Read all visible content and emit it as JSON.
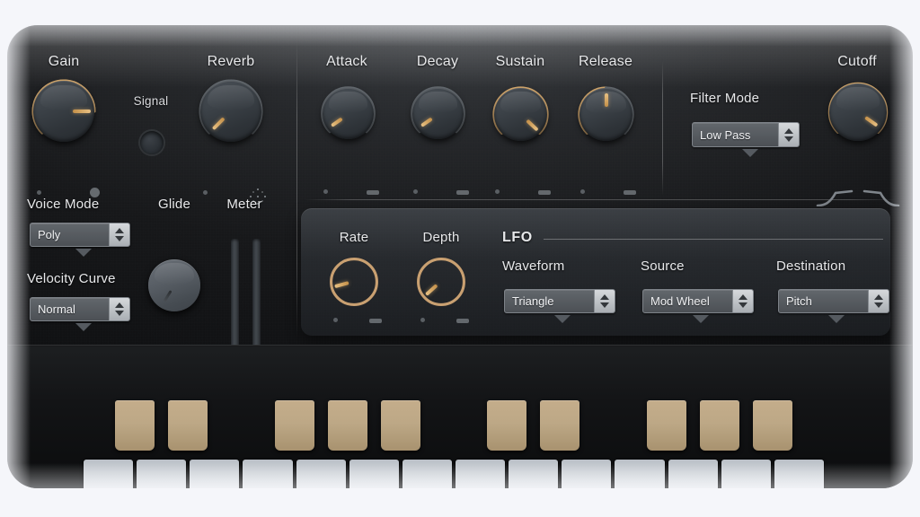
{
  "device": {
    "background_color": "#1a1c1e",
    "accent_color": "#e0b274",
    "page_background": "#f5f6fa"
  },
  "output_section": {
    "gain": {
      "label": "Gain",
      "arc": "active",
      "value_angle": 90
    },
    "signal": {
      "label": "Signal",
      "led_state": "off"
    },
    "reverb": {
      "label": "Reverb",
      "arc": "inactive",
      "value_angle": 225
    }
  },
  "voice_section": {
    "voice_mode": {
      "label": "Voice Mode",
      "value": "Poly"
    },
    "velocity_curve": {
      "label": "Velocity Curve",
      "value": "Normal"
    },
    "glide": {
      "label": "Glide",
      "value_angle": 212
    },
    "meter": {
      "label": "Meter",
      "bars": 2,
      "level": 0
    }
  },
  "envelope_section": {
    "knobs": [
      {
        "label": "Attack",
        "arc": "inactive",
        "value_angle": 215
      },
      {
        "label": "Decay",
        "arc": "inactive",
        "value_angle": 215
      },
      {
        "label": "Sustain",
        "arc": "active",
        "value_angle": 135
      },
      {
        "label": "Release",
        "arc": "active",
        "value_angle": 0
      }
    ]
  },
  "filter_section": {
    "filter_mode": {
      "label": "Filter Mode",
      "value": "Low Pass"
    },
    "cutoff": {
      "label": "Cutoff",
      "arc": "active",
      "value_angle": 125
    }
  },
  "lfo_section": {
    "title": "LFO",
    "rate": {
      "label": "Rate",
      "value_angle": 255
    },
    "depth": {
      "label": "Depth",
      "value_angle": 215
    },
    "waveform": {
      "label": "Waveform",
      "value": "Triangle"
    },
    "source": {
      "label": "Source",
      "value": "Mod Wheel"
    },
    "destination": {
      "label": "Destination",
      "value": "Pitch"
    }
  },
  "keyboard": {
    "white_key_count": 14,
    "black_key_pattern": [
      1,
      1,
      0,
      1,
      1,
      1,
      0,
      1,
      1,
      0,
      1,
      1,
      1,
      0
    ],
    "white_key_color": "#eceef1",
    "black_key_color": "#bda886"
  }
}
